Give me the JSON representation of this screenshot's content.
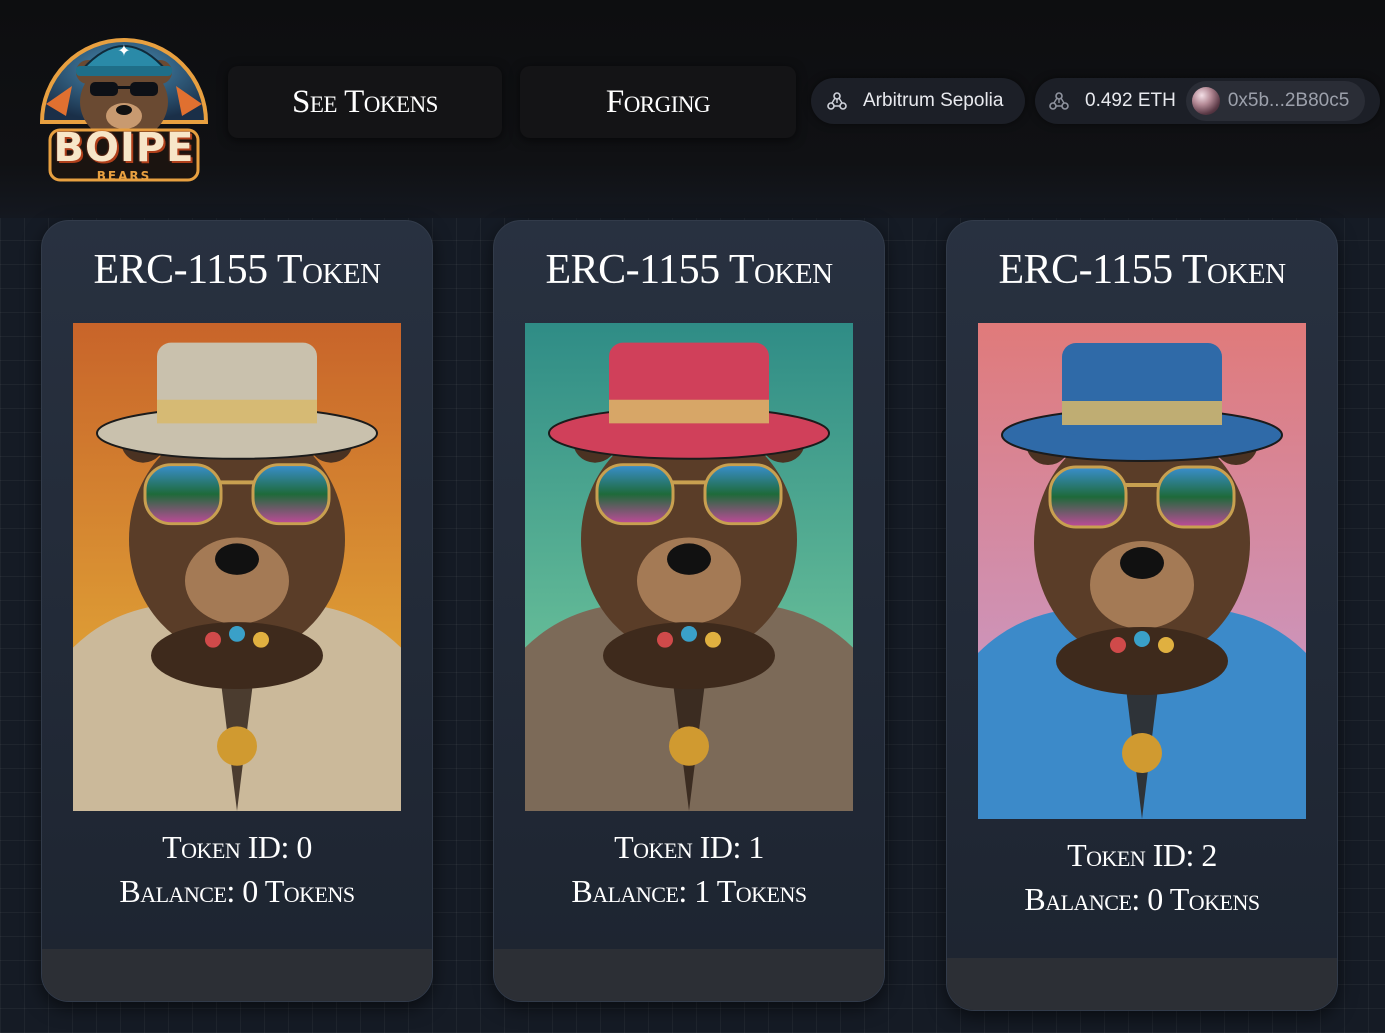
{
  "header": {
    "logo": {
      "word": "BOIPE",
      "sub": "BEARS"
    },
    "nav": {
      "see_tokens": "See Tokens",
      "forging": "Forging"
    },
    "wallet": {
      "network": "Arbitrum Sepolia",
      "balance": "0.492 ETH",
      "address": "0x5b...2B80c5"
    }
  },
  "cards": [
    {
      "title": "ERC-1155 Token",
      "id_label": "Token ID: 0",
      "balance_label": "Balance: 0 Tokens",
      "bg_top": "#c8642a",
      "bg_bottom": "#e8b83a",
      "hat": "#c9c1ad",
      "coat": "#cbb99a"
    },
    {
      "title": "ERC-1155 Token",
      "id_label": "Token ID: 1",
      "balance_label": "Balance: 1 Tokens",
      "bg_top": "#2f8c86",
      "bg_bottom": "#7fd3a0",
      "hat": "#d0405a",
      "coat": "#7c6a58"
    },
    {
      "title": "ERC-1155 Token",
      "id_label": "Token ID: 2",
      "balance_label": "Balance: 0 Tokens",
      "bg_top": "#e07a7a",
      "bg_bottom": "#c4a0d8",
      "hat": "#2f6aa8",
      "coat": "#3c8ac9"
    }
  ]
}
